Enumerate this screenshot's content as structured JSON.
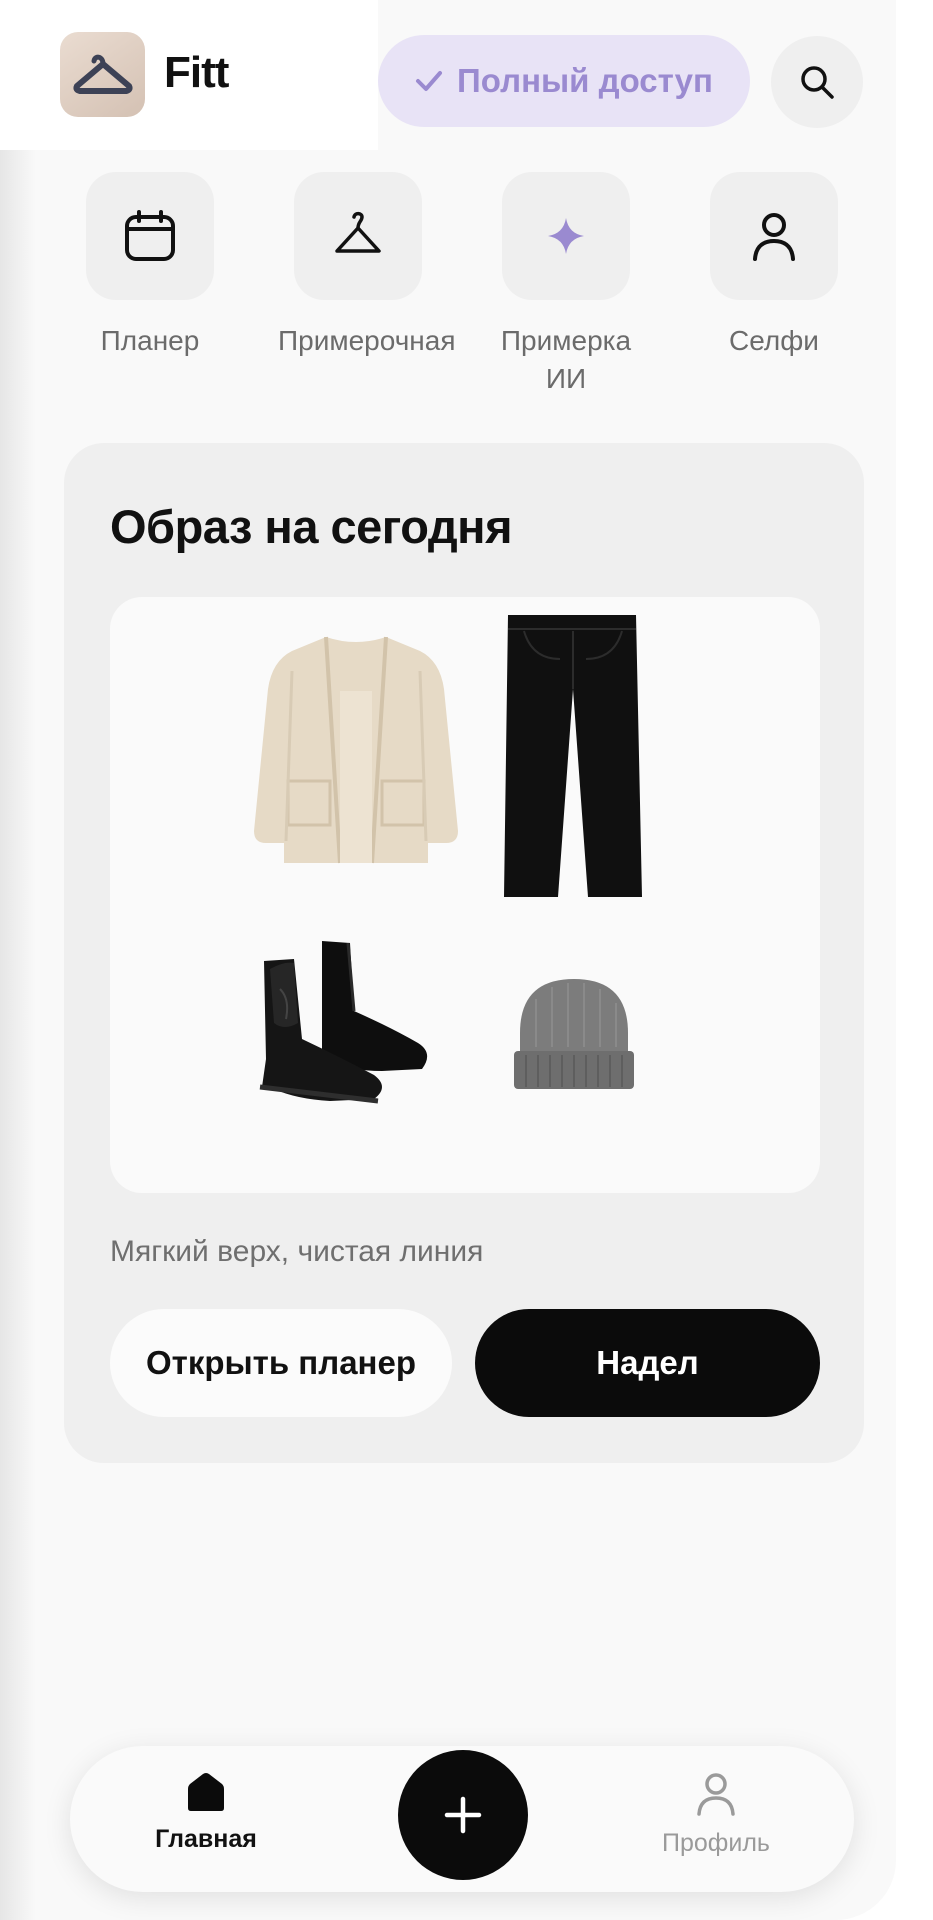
{
  "app": {
    "name": "Fitt",
    "logo_icon": "hanger-icon"
  },
  "header": {
    "access_label": "Полный доступ",
    "access_icon": "check-icon",
    "search_icon": "search-icon"
  },
  "quick_actions": [
    {
      "label": "Планер",
      "icon": "calendar-icon"
    },
    {
      "label": "Примерочная",
      "icon": "hanger-icon"
    },
    {
      "label": "Примерка ИИ",
      "icon": "sparkle-icon"
    },
    {
      "label": "Селфи",
      "icon": "person-icon"
    }
  ],
  "today": {
    "title": "Образ на сегодня",
    "items": [
      {
        "icon": "cardigan-icon"
      },
      {
        "icon": "jeans-icon"
      },
      {
        "icon": "boots-icon"
      },
      {
        "icon": "beanie-icon"
      }
    ],
    "subtitle": "Мягкий верх, чистая линия",
    "open_planner_label": "Открыть планер",
    "wore_label": "Надел"
  },
  "bottom_nav": {
    "home_label": "Главная",
    "profile_label": "Профиль",
    "add_icon": "plus-icon"
  },
  "colors": {
    "accent": "#9a8ad0",
    "accent_bg": "#e8e3f6",
    "primary": "#0b0b0b",
    "surface": "#efefef"
  }
}
